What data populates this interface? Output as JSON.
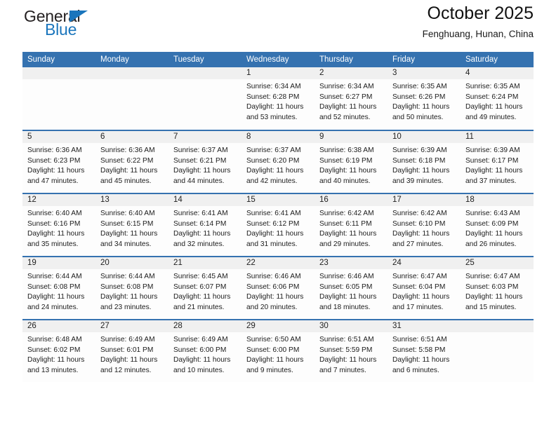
{
  "brand": {
    "name_part1": "General",
    "name_part2": "Blue",
    "accent_color": "#1a75bc",
    "triangle_icon": "triangle-icon"
  },
  "header": {
    "title": "October 2025",
    "location": "Fenghuang, Hunan, China",
    "header_bg_color": "#3572b0"
  },
  "weekday_headers": [
    "Sunday",
    "Monday",
    "Tuesday",
    "Wednesday",
    "Thursday",
    "Friday",
    "Saturday"
  ],
  "weeks": [
    [
      {
        "day": "",
        "sunrise": "",
        "sunset": "",
        "daylight1": "",
        "daylight2": ""
      },
      {
        "day": "",
        "sunrise": "",
        "sunset": "",
        "daylight1": "",
        "daylight2": ""
      },
      {
        "day": "",
        "sunrise": "",
        "sunset": "",
        "daylight1": "",
        "daylight2": ""
      },
      {
        "day": "1",
        "sunrise": "Sunrise: 6:34 AM",
        "sunset": "Sunset: 6:28 PM",
        "daylight1": "Daylight: 11 hours",
        "daylight2": "and 53 minutes."
      },
      {
        "day": "2",
        "sunrise": "Sunrise: 6:34 AM",
        "sunset": "Sunset: 6:27 PM",
        "daylight1": "Daylight: 11 hours",
        "daylight2": "and 52 minutes."
      },
      {
        "day": "3",
        "sunrise": "Sunrise: 6:35 AM",
        "sunset": "Sunset: 6:26 PM",
        "daylight1": "Daylight: 11 hours",
        "daylight2": "and 50 minutes."
      },
      {
        "day": "4",
        "sunrise": "Sunrise: 6:35 AM",
        "sunset": "Sunset: 6:24 PM",
        "daylight1": "Daylight: 11 hours",
        "daylight2": "and 49 minutes."
      }
    ],
    [
      {
        "day": "5",
        "sunrise": "Sunrise: 6:36 AM",
        "sunset": "Sunset: 6:23 PM",
        "daylight1": "Daylight: 11 hours",
        "daylight2": "and 47 minutes."
      },
      {
        "day": "6",
        "sunrise": "Sunrise: 6:36 AM",
        "sunset": "Sunset: 6:22 PM",
        "daylight1": "Daylight: 11 hours",
        "daylight2": "and 45 minutes."
      },
      {
        "day": "7",
        "sunrise": "Sunrise: 6:37 AM",
        "sunset": "Sunset: 6:21 PM",
        "daylight1": "Daylight: 11 hours",
        "daylight2": "and 44 minutes."
      },
      {
        "day": "8",
        "sunrise": "Sunrise: 6:37 AM",
        "sunset": "Sunset: 6:20 PM",
        "daylight1": "Daylight: 11 hours",
        "daylight2": "and 42 minutes."
      },
      {
        "day": "9",
        "sunrise": "Sunrise: 6:38 AM",
        "sunset": "Sunset: 6:19 PM",
        "daylight1": "Daylight: 11 hours",
        "daylight2": "and 40 minutes."
      },
      {
        "day": "10",
        "sunrise": "Sunrise: 6:39 AM",
        "sunset": "Sunset: 6:18 PM",
        "daylight1": "Daylight: 11 hours",
        "daylight2": "and 39 minutes."
      },
      {
        "day": "11",
        "sunrise": "Sunrise: 6:39 AM",
        "sunset": "Sunset: 6:17 PM",
        "daylight1": "Daylight: 11 hours",
        "daylight2": "and 37 minutes."
      }
    ],
    [
      {
        "day": "12",
        "sunrise": "Sunrise: 6:40 AM",
        "sunset": "Sunset: 6:16 PM",
        "daylight1": "Daylight: 11 hours",
        "daylight2": "and 35 minutes."
      },
      {
        "day": "13",
        "sunrise": "Sunrise: 6:40 AM",
        "sunset": "Sunset: 6:15 PM",
        "daylight1": "Daylight: 11 hours",
        "daylight2": "and 34 minutes."
      },
      {
        "day": "14",
        "sunrise": "Sunrise: 6:41 AM",
        "sunset": "Sunset: 6:14 PM",
        "daylight1": "Daylight: 11 hours",
        "daylight2": "and 32 minutes."
      },
      {
        "day": "15",
        "sunrise": "Sunrise: 6:41 AM",
        "sunset": "Sunset: 6:12 PM",
        "daylight1": "Daylight: 11 hours",
        "daylight2": "and 31 minutes."
      },
      {
        "day": "16",
        "sunrise": "Sunrise: 6:42 AM",
        "sunset": "Sunset: 6:11 PM",
        "daylight1": "Daylight: 11 hours",
        "daylight2": "and 29 minutes."
      },
      {
        "day": "17",
        "sunrise": "Sunrise: 6:42 AM",
        "sunset": "Sunset: 6:10 PM",
        "daylight1": "Daylight: 11 hours",
        "daylight2": "and 27 minutes."
      },
      {
        "day": "18",
        "sunrise": "Sunrise: 6:43 AM",
        "sunset": "Sunset: 6:09 PM",
        "daylight1": "Daylight: 11 hours",
        "daylight2": "and 26 minutes."
      }
    ],
    [
      {
        "day": "19",
        "sunrise": "Sunrise: 6:44 AM",
        "sunset": "Sunset: 6:08 PM",
        "daylight1": "Daylight: 11 hours",
        "daylight2": "and 24 minutes."
      },
      {
        "day": "20",
        "sunrise": "Sunrise: 6:44 AM",
        "sunset": "Sunset: 6:08 PM",
        "daylight1": "Daylight: 11 hours",
        "daylight2": "and 23 minutes."
      },
      {
        "day": "21",
        "sunrise": "Sunrise: 6:45 AM",
        "sunset": "Sunset: 6:07 PM",
        "daylight1": "Daylight: 11 hours",
        "daylight2": "and 21 minutes."
      },
      {
        "day": "22",
        "sunrise": "Sunrise: 6:46 AM",
        "sunset": "Sunset: 6:06 PM",
        "daylight1": "Daylight: 11 hours",
        "daylight2": "and 20 minutes."
      },
      {
        "day": "23",
        "sunrise": "Sunrise: 6:46 AM",
        "sunset": "Sunset: 6:05 PM",
        "daylight1": "Daylight: 11 hours",
        "daylight2": "and 18 minutes."
      },
      {
        "day": "24",
        "sunrise": "Sunrise: 6:47 AM",
        "sunset": "Sunset: 6:04 PM",
        "daylight1": "Daylight: 11 hours",
        "daylight2": "and 17 minutes."
      },
      {
        "day": "25",
        "sunrise": "Sunrise: 6:47 AM",
        "sunset": "Sunset: 6:03 PM",
        "daylight1": "Daylight: 11 hours",
        "daylight2": "and 15 minutes."
      }
    ],
    [
      {
        "day": "26",
        "sunrise": "Sunrise: 6:48 AM",
        "sunset": "Sunset: 6:02 PM",
        "daylight1": "Daylight: 11 hours",
        "daylight2": "and 13 minutes."
      },
      {
        "day": "27",
        "sunrise": "Sunrise: 6:49 AM",
        "sunset": "Sunset: 6:01 PM",
        "daylight1": "Daylight: 11 hours",
        "daylight2": "and 12 minutes."
      },
      {
        "day": "28",
        "sunrise": "Sunrise: 6:49 AM",
        "sunset": "Sunset: 6:00 PM",
        "daylight1": "Daylight: 11 hours",
        "daylight2": "and 10 minutes."
      },
      {
        "day": "29",
        "sunrise": "Sunrise: 6:50 AM",
        "sunset": "Sunset: 6:00 PM",
        "daylight1": "Daylight: 11 hours",
        "daylight2": "and 9 minutes."
      },
      {
        "day": "30",
        "sunrise": "Sunrise: 6:51 AM",
        "sunset": "Sunset: 5:59 PM",
        "daylight1": "Daylight: 11 hours",
        "daylight2": "and 7 minutes."
      },
      {
        "day": "31",
        "sunrise": "Sunrise: 6:51 AM",
        "sunset": "Sunset: 5:58 PM",
        "daylight1": "Daylight: 11 hours",
        "daylight2": "and 6 minutes."
      },
      {
        "day": "",
        "sunrise": "",
        "sunset": "",
        "daylight1": "",
        "daylight2": ""
      }
    ]
  ]
}
